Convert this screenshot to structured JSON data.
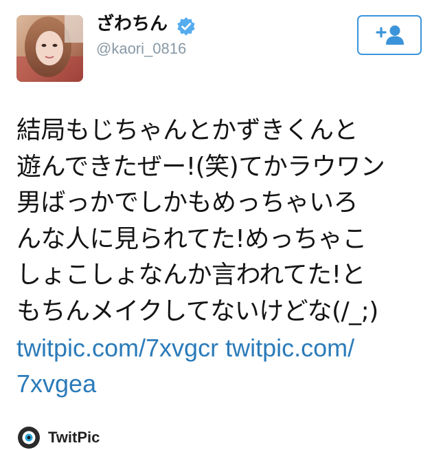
{
  "user": {
    "display_name": "ざわちん",
    "handle": "@kaori_0816",
    "verified": true
  },
  "follow_button": {
    "icon": "add-user-icon"
  },
  "tweet": {
    "lines": [
      "結局もじちゃんとかずきくんと",
      "遊んできたぜー!(笑)てかラウワン",
      "男ばっかでしかもめっちゃいろ",
      "んな人に見られてた!めっちゃこ",
      "しょこしょなんか言われてた!と",
      "もちんメイクしてないけどな(/_;)"
    ],
    "link_line_1a": "twitpic.com/7xvgcr",
    "link_line_1b": "twitpic.com/",
    "link_line_2": "7xvgea"
  },
  "card": {
    "source_name": "TwitPic",
    "icon": "twitpic-icon"
  },
  "colors": {
    "link": "#2b7bb9",
    "verified": "#55acee",
    "handle": "#8899a6",
    "follow_border": "#3b94d9"
  }
}
